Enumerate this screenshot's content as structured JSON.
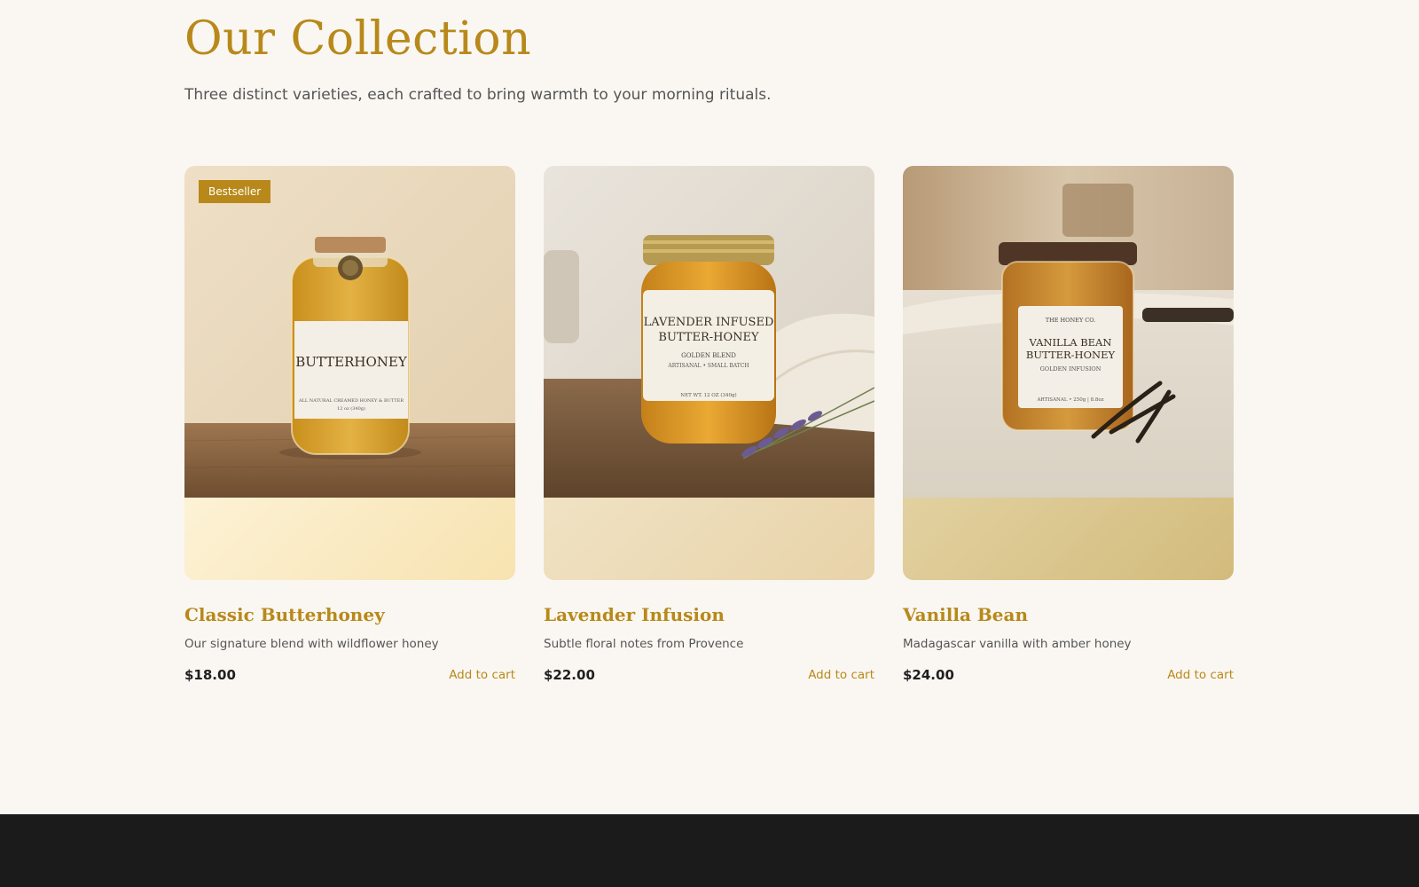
{
  "collection": {
    "title": "Our Collection",
    "subtitle": "Three distinct varieties, each crafted to bring warmth to your morning rituals."
  },
  "products": [
    {
      "name": "Classic Butterhoney",
      "description": "Our signature blend with wildflower honey",
      "price": "$18.00",
      "cta": "Add to cart",
      "badge": "Bestseller",
      "label_lines": [
        "BUTTERHONEY",
        "ALL NATURAL CREAMED HONEY & BUTTER",
        "12 oz (340g)"
      ],
      "band_colors": [
        "#fdf2d6",
        "#f7e3b0"
      ]
    },
    {
      "name": "Lavender Infusion",
      "description": "Subtle floral notes from Provence",
      "price": "$22.00",
      "cta": "Add to cart",
      "label_lines": [
        "LAVENDER INFUSED",
        "BUTTER-HONEY",
        "GOLDEN BLEND",
        "ARTISANAL • SMALL BATCH",
        "NET WT. 12 OZ (340g)"
      ],
      "band_colors": [
        "#f0e2c4",
        "#e8d3a8"
      ]
    },
    {
      "name": "Vanilla Bean",
      "description": "Madagascar vanilla with amber honey",
      "price": "$24.00",
      "cta": "Add to cart",
      "label_lines": [
        "THE HONEY CO.",
        "VANILLA BEAN",
        "BUTTER-HONEY",
        "GOLDEN INFUSION",
        "ARTISANAL • 250g | 8.8oz"
      ],
      "band_colors": [
        "#e2d1a0",
        "#d2bb7c"
      ]
    }
  ],
  "colors": {
    "accent": "#b8891a",
    "background": "#faf7f2",
    "footer": "#1b1b1c"
  }
}
